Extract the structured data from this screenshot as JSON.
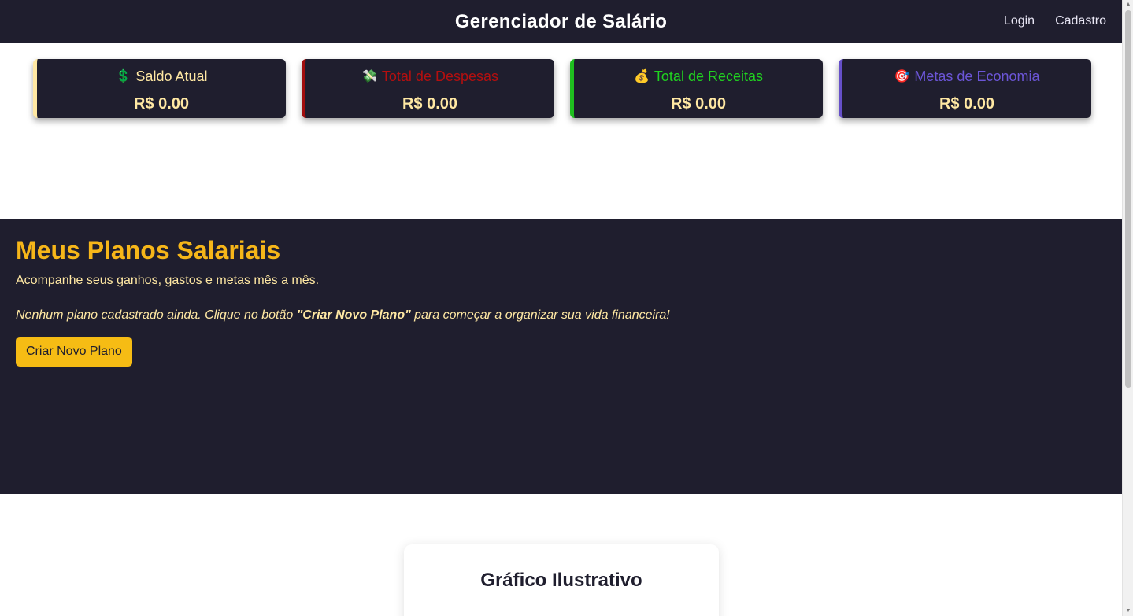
{
  "header": {
    "title": "Gerenciador de Salário",
    "nav": {
      "login": "Login",
      "signup": "Cadastro"
    }
  },
  "cards": [
    {
      "icon": "💲",
      "icon_name": "dollar-sign-icon",
      "label": "Saldo Atual",
      "value": "R$ 0.00",
      "color": "#ffe8a3"
    },
    {
      "icon": "💸",
      "icon_name": "money-with-wings-icon",
      "label": "Total de Despesas",
      "value": "R$ 0.00",
      "color": "#b40f0f"
    },
    {
      "icon": "💰",
      "icon_name": "money-bag-icon",
      "label": "Total de Receitas",
      "value": "R$ 0.00",
      "color": "#20d320"
    },
    {
      "icon": "🎯",
      "icon_name": "target-icon",
      "label": "Metas de Economia",
      "value": "R$ 0.00",
      "color": "#6b55d6"
    }
  ],
  "plans": {
    "title": "Meus Planos Salariais",
    "subtitle": "Acompanhe seus ganhos, gastos e metas mês a mês.",
    "empty_prefix": "Nenhum plano cadastrado ainda. Clique no botão ",
    "empty_highlight": "\"Criar Novo Plano\"",
    "empty_suffix": " para começar a organizar sua vida financeira!",
    "button_label": "Criar Novo Plano"
  },
  "chart_section": {
    "title": "Gráfico Ilustrativo"
  },
  "colors": {
    "background_dark": "#1f1e2e",
    "accent_yellow": "#f6bc14",
    "text_cream": "#ffe8a3"
  }
}
